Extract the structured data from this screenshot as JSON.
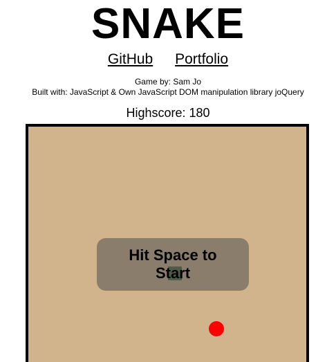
{
  "title": "SNAKE",
  "links": {
    "github": "GitHub",
    "portfolio": "Portfolio"
  },
  "credits": {
    "author": "Game by: Sam Jo",
    "built_with": "Built with: JavaScript & Own JavaScript DOM manipulation library joQuery"
  },
  "highscore": "Highscore: 180",
  "game": {
    "overlay_text": "Hit Space to Start",
    "colors": {
      "board": "#d2b48c",
      "snake": "#4a6d3e",
      "food": "#ff0000"
    }
  }
}
